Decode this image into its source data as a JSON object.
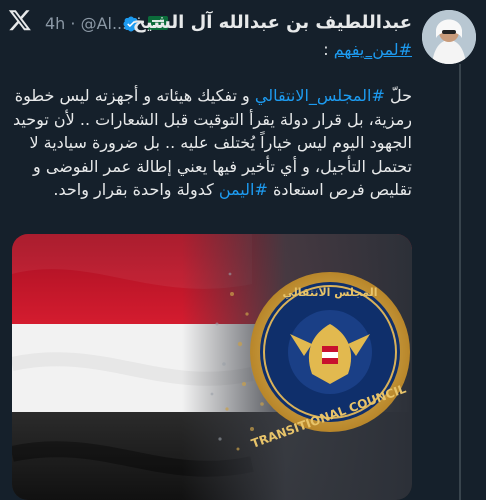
{
  "header": {
    "display_name": "عبداللطيف بن عبدالله آل الشيخ",
    "time_handle": "4h · @Al..."
  },
  "tweet": {
    "hashtag_line_tag": "#لمن_يفهم",
    "hashtag_line_suffix": " :",
    "seg1": "حلّ ",
    "tag1": "#المجلس_الانتقالي",
    "seg2": " و تفكيك هيئاته و أجهزته ليس خطوة رمزية، بل قرار دولة يقرأ التوقيت قبل الشعارات .. لأن توحيد الجهود اليوم ليس خياراً يُختلف عليه .. بل ضرورة سيادية لا تحتمل التأجيل، و أي تأخير فيها يعني إطالة عمر الفوضى و تقليص فرص استعادة ",
    "tag2": "#اليمن",
    "seg3": " كدولة واحدة بقرار واحد."
  },
  "media": {
    "emblem_text": "TRANSITIONAL COUNCIL",
    "emblem_text_ar": "المجلس الانتقالي",
    "flag_colors": [
      "#c8102e",
      "#ffffff",
      "#000000"
    ]
  },
  "colors": {
    "background": "#15202b",
    "hashtag": "#1d9bf0",
    "verified": "#1d9bf0",
    "muted": "#8b98a5"
  }
}
